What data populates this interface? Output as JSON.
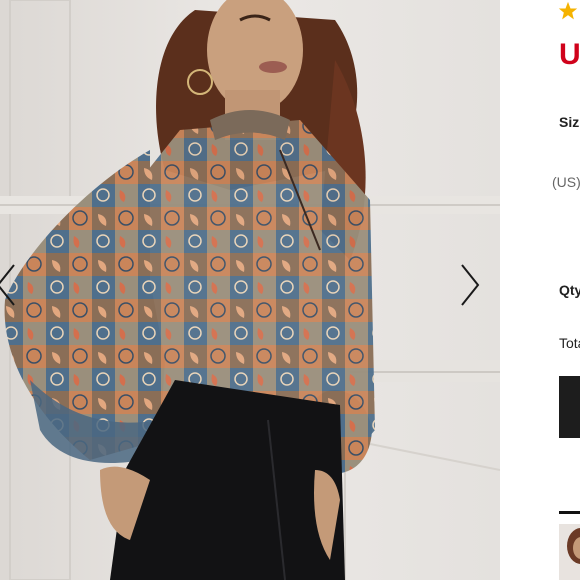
{
  "gallery": {
    "next_icon": "chevron-right-icon",
    "prev_icon": "chevron-left-icon"
  },
  "product": {
    "rating_icon": "star-icon",
    "price_prefix": "U",
    "size_label": "Siz",
    "size_hint": "(US)",
    "qty_label": "Qty",
    "total_label": "Tota"
  },
  "colors": {
    "price_red": "#d0021b",
    "star_gold": "#f5b301",
    "button_dark": "#1d1d1d"
  }
}
